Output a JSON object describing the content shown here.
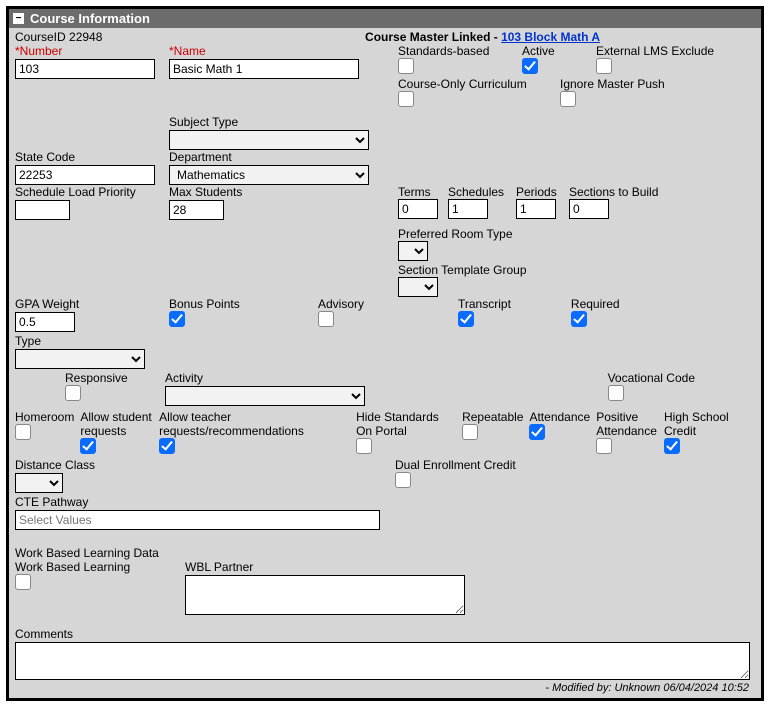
{
  "title": "Course Information",
  "courseIdLabel": "CourseID 22948",
  "masterLinked": {
    "label": "Course Master Linked - ",
    "link": "103 Block Math A"
  },
  "number": {
    "label": "*Number",
    "value": "103"
  },
  "name": {
    "label": "*Name",
    "value": "Basic Math 1"
  },
  "topChecks": {
    "standardsBased": {
      "label": "Standards-based",
      "checked": false
    },
    "active": {
      "label": "Active",
      "checked": true
    },
    "externalLms": {
      "label": "External LMS Exclude",
      "checked": false
    },
    "courseOnly": {
      "label": "Course-Only Curriculum",
      "checked": false
    },
    "ignoreMaster": {
      "label": "Ignore Master Push",
      "checked": false
    }
  },
  "subjectType": {
    "label": "Subject Type",
    "value": ""
  },
  "stateCode": {
    "label": "State Code",
    "value": "22253"
  },
  "department": {
    "label": "Department",
    "value": "Mathematics"
  },
  "schedLoadPriority": {
    "label": "Schedule Load Priority",
    "value": ""
  },
  "maxStudents": {
    "label": "Max Students",
    "value": "28"
  },
  "terms": {
    "label": "Terms",
    "value": "0"
  },
  "schedules": {
    "label": "Schedules",
    "value": "1"
  },
  "periods": {
    "label": "Periods",
    "value": "1"
  },
  "sectionsBuild": {
    "label": "Sections to Build",
    "value": "0"
  },
  "preferredRoom": {
    "label": "Preferred Room Type",
    "value": ""
  },
  "sectionTemplate": {
    "label": "Section Template Group",
    "value": ""
  },
  "gpaWeight": {
    "label": "GPA Weight",
    "value": "0.5"
  },
  "bonusPoints": {
    "label": "Bonus Points",
    "checked": true
  },
  "advisory": {
    "label": "Advisory",
    "checked": false
  },
  "transcript": {
    "label": "Transcript",
    "checked": true
  },
  "required": {
    "label": "Required",
    "checked": true
  },
  "type": {
    "label": "Type",
    "value": ""
  },
  "responsive": {
    "label": "Responsive",
    "checked": false
  },
  "activity": {
    "label": "Activity",
    "value": ""
  },
  "vocCode": {
    "label": "Vocational Code",
    "checked": false
  },
  "homeroom": {
    "label": "Homeroom",
    "checked": false
  },
  "allowStudent": {
    "label": "Allow student requests",
    "checked": true
  },
  "allowTeacher": {
    "label": "Allow teacher requests/recommendations",
    "checked": true
  },
  "hideStandards": {
    "label": "Hide Standards On Portal",
    "checked": false
  },
  "repeatable": {
    "label": "Repeatable",
    "checked": false
  },
  "attendance": {
    "label": "Attendance",
    "checked": true
  },
  "posAttendance": {
    "label": "Positive Attendance",
    "checked": false
  },
  "hsCredit": {
    "label": "High School Credit",
    "checked": true
  },
  "distanceClass": {
    "label": "Distance Class",
    "value": ""
  },
  "dualEnroll": {
    "label": "Dual Enrollment Credit",
    "checked": false
  },
  "ctePathway": {
    "label": "CTE Pathway",
    "placeholder": "Select Values"
  },
  "wblSection": "Work Based Learning Data",
  "wbl": {
    "label": "Work Based Learning",
    "checked": false
  },
  "wblPartner": {
    "label": "WBL Partner",
    "value": ""
  },
  "comments": {
    "label": "Comments",
    "value": ""
  },
  "footer": "- Modified by: Unknown 06/04/2024 10:52"
}
